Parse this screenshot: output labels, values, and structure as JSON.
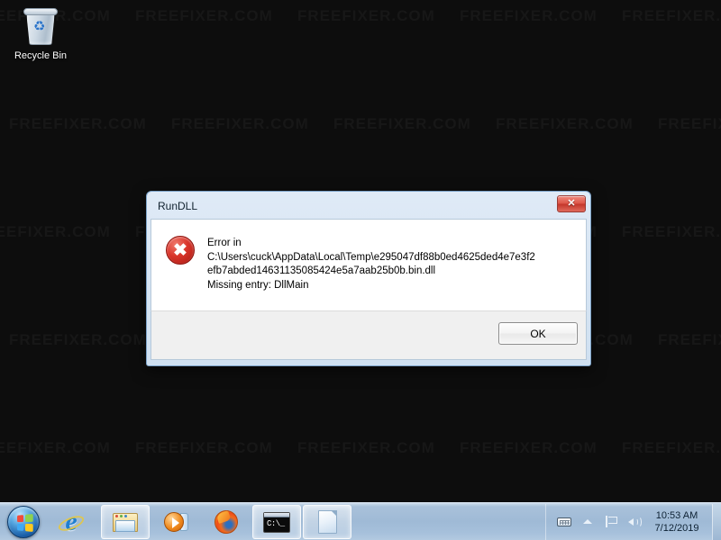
{
  "desktop": {
    "background_color": "#0d0d0d",
    "watermark_text": "FREEFIXER.COM",
    "icons": [
      {
        "name": "recycle-bin",
        "label": "Recycle Bin",
        "glyph": "♻"
      }
    ]
  },
  "dialog": {
    "title": "RunDLL",
    "close_label": "✕",
    "icon_name": "error-icon",
    "icon_glyph": "✖",
    "message_lines": [
      "Error in",
      "C:\\Users\\cuck\\AppData\\Local\\Temp\\e295047df88b0ed4625ded4e7e3f2",
      "efb7abded14631135085424e5a7aab25b0b.bin.dll",
      "Missing entry: DllMain"
    ],
    "ok_label": "OK",
    "accent_color": "#d9342a",
    "frame_color": "#cfe0f1"
  },
  "taskbar": {
    "background_color": "#a8c2dd",
    "start_name": "start-orb",
    "items": [
      {
        "name": "taskbar-item-internet-explorer",
        "label": "Internet Explorer",
        "active": false
      },
      {
        "name": "taskbar-item-windows-explorer",
        "label": "Windows Explorer",
        "active": true
      },
      {
        "name": "taskbar-item-media-player",
        "label": "Windows Media Player",
        "active": false
      },
      {
        "name": "taskbar-item-firefox",
        "label": "Mozilla Firefox",
        "active": false
      },
      {
        "name": "taskbar-item-command-prompt",
        "label": "Command Prompt",
        "active": true
      },
      {
        "name": "taskbar-item-document",
        "label": "Document",
        "active": true
      }
    ],
    "tray": {
      "icons": [
        {
          "name": "keyboard-icon",
          "label": "Keyboard layout"
        },
        {
          "name": "chevron-up-icon",
          "label": "Show hidden icons"
        },
        {
          "name": "flag-icon",
          "label": "Action Center"
        },
        {
          "name": "speaker-icon",
          "label": "Volume"
        }
      ],
      "clock": {
        "time": "10:53 AM",
        "date": "7/12/2019"
      },
      "show_desktop_label": "Show desktop"
    }
  }
}
